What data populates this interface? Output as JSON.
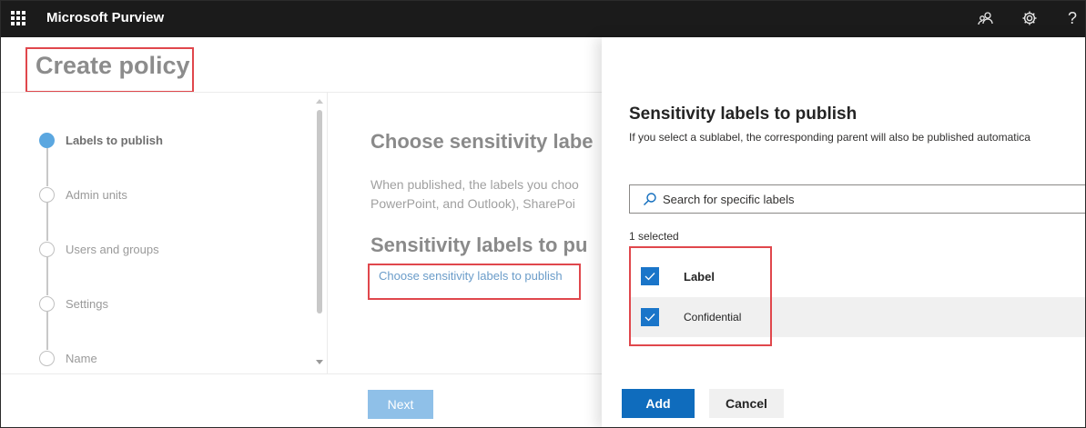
{
  "topbar": {
    "app_title": "Microsoft Purview",
    "icons": [
      "waffle-icon",
      "people-icon",
      "gear-icon",
      "help-icon"
    ],
    "help_glyph": "?"
  },
  "page": {
    "title": "Create policy",
    "steps": [
      {
        "label": "Labels to publish",
        "active": true
      },
      {
        "label": "Admin units",
        "active": false
      },
      {
        "label": "Users and groups",
        "active": false
      },
      {
        "label": "Settings",
        "active": false
      },
      {
        "label": "Name",
        "active": false
      }
    ],
    "main_heading": "Choose sensitivity labe",
    "main_text_line1": "When published, the labels you choo",
    "main_text_line2": "PowerPoint, and Outlook), SharePoi",
    "sub_heading": "Sensitivity labels to pu",
    "choose_link": "Choose sensitivity labels to publish",
    "next_button": "Next"
  },
  "flyout": {
    "title": "Sensitivity labels to publish",
    "subtitle": "If you select a sublabel, the corresponding parent will also be published automatica",
    "search_placeholder": "Search for specific labels",
    "selected_count": "1 selected",
    "column_header": "Label",
    "items": [
      {
        "label": "Confidential",
        "checked": true
      }
    ],
    "add_button": "Add",
    "cancel_button": "Cancel"
  },
  "colors": {
    "accent": "#0f6cbd",
    "highlight_box": "#e0474c",
    "topbar": "#1b1b1b"
  }
}
